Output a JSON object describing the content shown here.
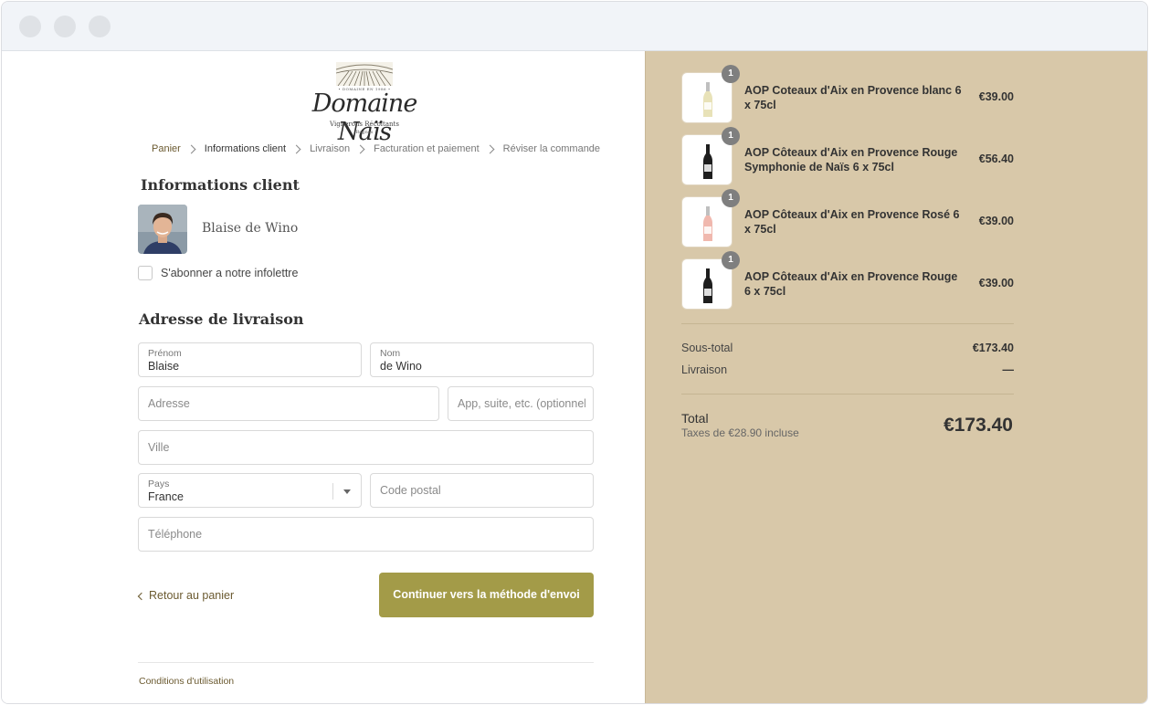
{
  "brand": {
    "established": "• DOMAINE EN 1986 •",
    "name": "Domaine Naïs",
    "subtitle": "Vignerons Récoltants",
    "location": "Rognes"
  },
  "breadcrumb": [
    {
      "label": "Panier",
      "state": "link"
    },
    {
      "label": "Informations client",
      "state": "current"
    },
    {
      "label": "Livraison",
      "state": "inactive"
    },
    {
      "label": "Facturation et paiement",
      "state": "inactive"
    },
    {
      "label": "Réviser la commande",
      "state": "inactive"
    }
  ],
  "customer": {
    "heading": "Informations client",
    "name": "Blaise de Wino",
    "newsletter_label": "S'abonner a notre infolettre",
    "newsletter_checked": false
  },
  "shipping": {
    "heading": "Adresse de livraison",
    "first_name": {
      "label": "Prénom",
      "value": "Blaise"
    },
    "last_name": {
      "label": "Nom",
      "value": "de Wino"
    },
    "address": {
      "placeholder": "Adresse"
    },
    "apartment": {
      "placeholder": "App, suite, etc. (optionnel)"
    },
    "city": {
      "placeholder": "Ville"
    },
    "country": {
      "label": "Pays",
      "value": "France"
    },
    "postal_code": {
      "placeholder": "Code postal"
    },
    "phone": {
      "placeholder": "Téléphone"
    }
  },
  "actions": {
    "back_label": "Retour au panier",
    "continue_label": "Continuer vers la méthode d'envoi"
  },
  "footer": {
    "terms_label": "Conditions d'utilisation"
  },
  "cart": {
    "items": [
      {
        "quantity": "1",
        "name": "AOP Coteaux d'Aix en Provence blanc 6 x 75cl",
        "price": "€39.00",
        "wine_color": "#e8e2b8"
      },
      {
        "quantity": "1",
        "name": "AOP Côteaux d'Aix en Provence Rouge Symphonie de Naïs 6 x 75cl",
        "price": "€56.40",
        "wine_color": "#1e1e1e"
      },
      {
        "quantity": "1",
        "name": "AOP Côteaux d'Aix en Provence Rosé 6 x 75cl",
        "price": "€39.00",
        "wine_color": "#f0b8ae"
      },
      {
        "quantity": "1",
        "name": "AOP Côteaux d'Aix en Provence Rouge 6 x 75cl",
        "price": "€39.00",
        "wine_color": "#1e1e1e"
      }
    ],
    "subtotal_label": "Sous-total",
    "subtotal_value": "€173.40",
    "shipping_label": "Livraison",
    "shipping_value": "—",
    "total_label": "Total",
    "tax_note": "Taxes de €28.90 incluse",
    "total_value": "€173.40"
  },
  "colors": {
    "accent_button": "#a39b48",
    "sidebar_background": "#d8c8a9",
    "link": "#6b5a30"
  }
}
